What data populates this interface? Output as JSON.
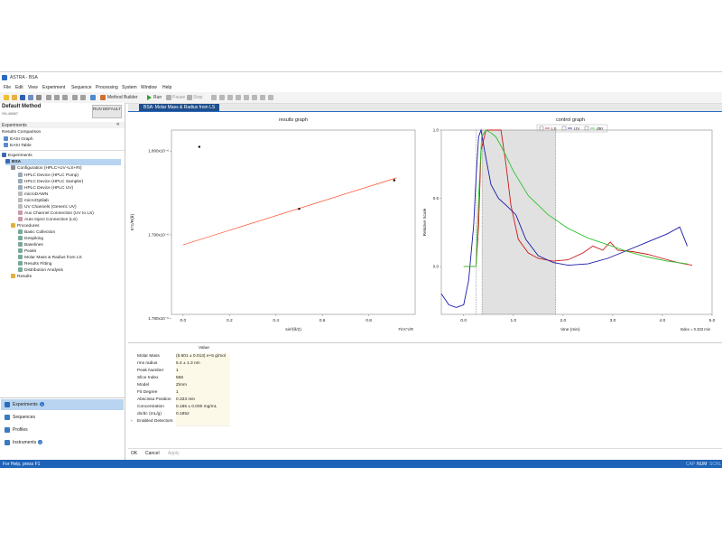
{
  "window": {
    "title": "ASTRA - BSA"
  },
  "menu": [
    "File",
    "Edit",
    "View",
    "Experiment",
    "Sequence",
    "Processing",
    "System",
    "Window",
    "Help"
  ],
  "toolbar": {
    "method_builder": "Method Builder",
    "run": "Run",
    "pause": "Pause",
    "stop": "Stop"
  },
  "left": {
    "method_title": "Default Method",
    "method_id": "SN-45867",
    "run_button": "RUN DEFAULT",
    "experiments_header": "Experiments",
    "collapse": "«",
    "results_comparison": "Results Comparison",
    "easi_graph": "EASI Graph",
    "easi_table": "EASI Table",
    "experiments_node": "Experiments",
    "bsa_node": "BSA",
    "configuration": "Configuration (HPLC+UV+LS+RI)",
    "config_items": [
      "HPLC Device (HPLC Pump)",
      "HPLC Device (HPLC Sampler)",
      "HPLC Device (HPLC UV)",
      "microDAWN",
      "microOptilab",
      "UV Channels (Generic UV)",
      "Aux Channel Connection (UV to LS)",
      "Auto Inject Connection (LS)"
    ],
    "procedures": "Procedures",
    "procedure_items": [
      "Basic Collection",
      "Despiking",
      "Baselines",
      "Peaks",
      "Molar Mass & Radius from LS",
      "Results Fitting",
      "Distribution Analysis"
    ],
    "results": "Results",
    "nav": [
      {
        "label": "Experiments",
        "badge": "1"
      },
      {
        "label": "Sequences",
        "badge": ""
      },
      {
        "label": "Profiles",
        "badge": ""
      },
      {
        "label": "Instruments",
        "badge": "0"
      }
    ]
  },
  "main": {
    "tab": "BSA: Molar Mass & Radius from LS"
  },
  "chart_data": [
    {
      "type": "scatter",
      "title": "results graph",
      "xlabel": "sin²(θ/2)",
      "ylabel": "K*c/R(θ)",
      "x_ticks": [
        "0.0",
        "0.2",
        "0.4",
        "0.6",
        "0.8"
      ],
      "y_ticks": [
        "1.780x10⁻⁶",
        "1.790x10⁻⁶",
        "1.800x10⁻⁶"
      ],
      "xlim": [
        -0.05,
        1.0
      ],
      "ylim": [
        1.7805,
        1.8025
      ],
      "points": [
        [
          0.07,
          1.8005
        ],
        [
          0.5,
          1.7931
        ],
        [
          0.91,
          1.7965
        ]
      ],
      "fit_line": [
        [
          0.0,
          1.7888
        ],
        [
          0.92,
          1.7968
        ]
      ],
      "fit_label": "Fit K*c/R",
      "point_color": "#000000",
      "fit_color": "#ff4a2a"
    },
    {
      "type": "line",
      "title": "control graph",
      "legend": [
        "LS",
        "UV",
        "dRI"
      ],
      "legend_placement": "top",
      "xlabel": "time (min)",
      "ylabel": "Relative Scale",
      "x_ticks": [
        "0.0",
        "1.0",
        "2.0",
        "3.0",
        "4.0",
        "5.0"
      ],
      "y_ticks": [
        "0.0",
        "0.5",
        "1.0"
      ],
      "xlim": [
        -0.45,
        5.0
      ],
      "ylim": [
        -0.35,
        1.0
      ],
      "index_label": "Index = 0.333 min",
      "shaded_region": [
        0.37,
        1.85
      ],
      "marker_lines": [
        0.25,
        0.37,
        1.85
      ],
      "series": [
        {
          "name": "LS",
          "color": "#cc1a1a",
          "x": [
            0.0,
            0.25,
            0.3,
            0.35,
            0.45,
            0.6,
            0.75,
            0.85,
            0.95,
            1.1,
            1.3,
            1.5,
            1.8,
            2.1,
            2.4,
            2.6,
            2.8,
            2.95,
            3.1,
            3.4,
            3.7,
            4.0,
            4.3,
            4.6
          ],
          "y": [
            0.0,
            0.0,
            0.3,
            0.85,
            1.0,
            1.0,
            1.0,
            0.75,
            0.45,
            0.2,
            0.1,
            0.06,
            0.04,
            0.05,
            0.1,
            0.15,
            0.12,
            0.18,
            0.12,
            0.11,
            0.09,
            0.06,
            0.03,
            0.01
          ]
        },
        {
          "name": "UV",
          "color": "#1a1aa8",
          "x": [
            -0.45,
            -0.3,
            -0.15,
            0.0,
            0.1,
            0.2,
            0.25,
            0.3,
            0.35,
            0.42,
            0.55,
            0.7,
            0.85,
            1.05,
            1.25,
            1.5,
            1.8,
            2.1,
            2.5,
            2.9,
            3.3,
            3.7,
            4.1,
            4.35,
            4.5
          ],
          "y": [
            -0.2,
            -0.28,
            -0.3,
            -0.28,
            -0.1,
            0.3,
            0.65,
            0.95,
            1.0,
            0.85,
            0.6,
            0.5,
            0.45,
            0.38,
            0.2,
            0.08,
            0.03,
            0.01,
            0.02,
            0.06,
            0.12,
            0.18,
            0.24,
            0.29,
            0.15
          ]
        },
        {
          "name": "dRI",
          "color": "#2fc22f",
          "x": [
            0.0,
            0.25,
            0.3,
            0.36,
            0.45,
            0.55,
            0.65,
            0.8,
            1.0,
            1.3,
            1.7,
            2.1,
            2.5,
            2.9,
            3.3,
            3.7,
            4.1,
            4.5
          ],
          "y": [
            0.0,
            0.0,
            0.5,
            0.95,
            1.0,
            0.98,
            0.95,
            0.85,
            0.7,
            0.52,
            0.38,
            0.28,
            0.21,
            0.16,
            0.11,
            0.07,
            0.04,
            0.02
          ]
        }
      ]
    }
  ],
  "props": {
    "value_header": "Value",
    "rows": [
      {
        "name": "Molar Mass",
        "value": "(5.601 ± 0.013) e+5 g/mol"
      },
      {
        "name": "rms radius",
        "value": "5.4 ± 1.3 nm"
      },
      {
        "name": "Peak Number",
        "value": "1"
      },
      {
        "name": "Slice Index",
        "value": "566"
      },
      {
        "name": "Model",
        "value": "Zimm"
      },
      {
        "name": "Fit Degree",
        "value": "1"
      },
      {
        "name": "Abscissa Position",
        "value": "0.333 min"
      },
      {
        "name": "Concentration",
        "value": "0.185 ± 0.000 mg/mL"
      },
      {
        "name": "dn/dc (mL/g)",
        "value": "0.1852"
      },
      {
        "name": "Enabled Detectors",
        "value": ""
      }
    ]
  },
  "buttons": {
    "ok": "OK",
    "cancel": "Cancel",
    "apply": "Apply"
  },
  "status": {
    "text": "For Help, press F1",
    "caps": "CAP",
    "num": "NUM",
    "scrl": "SCRL"
  }
}
